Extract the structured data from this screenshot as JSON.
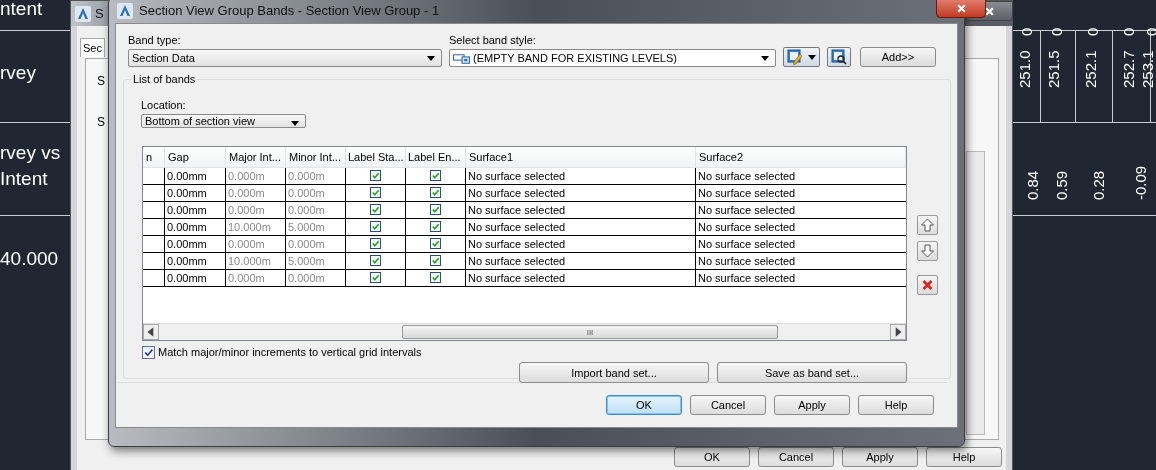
{
  "drawing": {
    "left_labels": [
      "ntent",
      "rvey",
      "rvey vs",
      "Intent",
      "40.000"
    ],
    "top_values": [
      "0",
      "0",
      "0",
      "0",
      "0"
    ],
    "elevations": [
      "251.0",
      "251.5",
      "252.1",
      "252.7",
      "253.1"
    ],
    "differences": [
      "0.84",
      "0.59",
      "0.28",
      "-0.09"
    ]
  },
  "back_dialog": {
    "title": "S",
    "tab": {
      "label": "Sec",
      "selected": true
    },
    "labels": [
      "S",
      "S"
    ],
    "buttons": [
      "OK",
      "Cancel",
      "Apply",
      "Help"
    ]
  },
  "dialog": {
    "title": "Section View Group Bands - Section View Group - 1",
    "band_type": {
      "label": "Band type:",
      "value": "Section Data"
    },
    "band_style": {
      "label": "Select band style:",
      "value": "(EMPTY BAND FOR EXISTING LEVELS)"
    },
    "add_button": "Add>>",
    "group_title": "List of bands",
    "location": {
      "label": "Location:",
      "value": "Bottom of section view"
    },
    "columns": [
      "n",
      "Gap",
      "Major Int...",
      "Minor Int...",
      "Label Sta...",
      "Label En...",
      "Surface1",
      "Surface2"
    ],
    "rows": [
      {
        "gap": "0.00mm",
        "major": "0.000m",
        "minor": "0.000m",
        "label_start": true,
        "label_end": true,
        "surface1": "No surface selected",
        "surface2": "No surface selected"
      },
      {
        "gap": "0.00mm",
        "major": "0.000m",
        "minor": "0.000m",
        "label_start": true,
        "label_end": true,
        "surface1": "No surface selected",
        "surface2": "No surface selected"
      },
      {
        "gap": "0.00mm",
        "major": "0.000m",
        "minor": "0.000m",
        "label_start": true,
        "label_end": true,
        "surface1": "No surface selected",
        "surface2": "No surface selected"
      },
      {
        "gap": "0.00mm",
        "major": "10.000m",
        "minor": "5.000m",
        "label_start": true,
        "label_end": true,
        "surface1": "No surface selected",
        "surface2": "No surface selected"
      },
      {
        "gap": "0.00mm",
        "major": "0.000m",
        "minor": "0.000m",
        "label_start": true,
        "label_end": true,
        "surface1": "No surface selected",
        "surface2": "No surface selected"
      },
      {
        "gap": "0.00mm",
        "major": "10.000m",
        "minor": "5.000m",
        "label_start": true,
        "label_end": true,
        "surface1": "No surface selected",
        "surface2": "No surface selected"
      },
      {
        "gap": "0.00mm",
        "major": "0.000m",
        "minor": "0.000m",
        "label_start": true,
        "label_end": true,
        "surface1": "No surface selected",
        "surface2": "No surface selected"
      }
    ],
    "scroll_grip": "III",
    "match_option": {
      "label": "Match major/minor increments to vertical grid intervals",
      "checked": true
    },
    "import_button": "Import band set...",
    "save_button": "Save as band set...",
    "buttons": [
      "OK",
      "Cancel",
      "Apply",
      "Help"
    ]
  }
}
